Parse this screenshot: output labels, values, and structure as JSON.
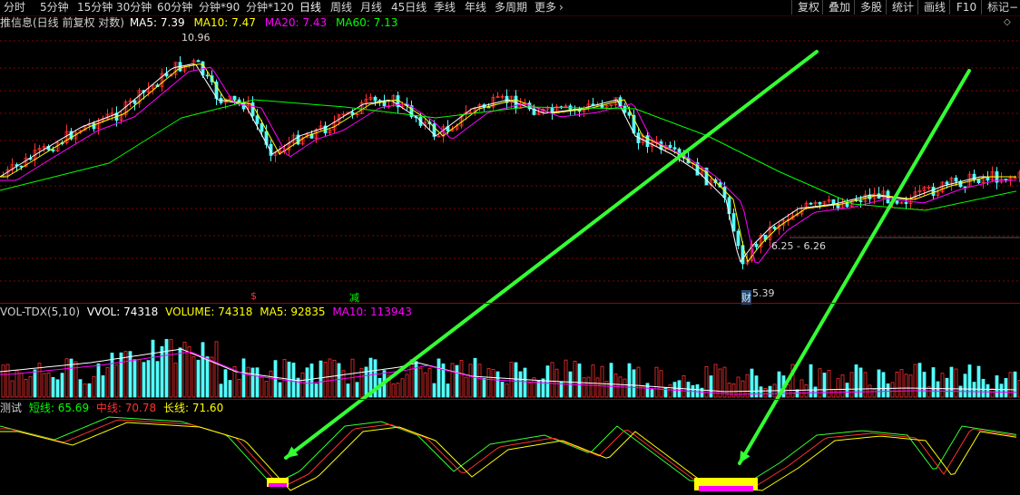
{
  "toolbar": {
    "periods": [
      "分时",
      "5分钟",
      "15分钟",
      "30分钟",
      "60分钟",
      "分钟*90",
      "分钟*120",
      "日线",
      "周线",
      "月线",
      "45日线",
      "季线",
      "年线",
      "多周期",
      "更多"
    ],
    "active_period": "日线",
    "more_chevron": "›",
    "right_buttons": [
      "复权",
      "叠加",
      "多股",
      "统计",
      "画线",
      "F10",
      "标记"
    ],
    "minus_icon": "−"
  },
  "main_panel": {
    "title": "推信息(日线 前复权 对数)",
    "ma5_label": "MA5:",
    "ma5_value": "7.39",
    "ma10_label": "MA10:",
    "ma10_value": "7.47",
    "ma20_label": "MA20:",
    "ma20_value": "7.43",
    "ma60_label": "MA60:",
    "ma60_value": "7.13",
    "high_label": "10.96",
    "low_label": "5.39",
    "range_label": "6.25 - 6.26",
    "event_marker_1": "$",
    "event_marker_2": "减",
    "event_marker_3": "财",
    "diamond_icon": "◇"
  },
  "volume_panel": {
    "title": "VOL-TDX(5,10)",
    "vvol_label": "VVOL:",
    "vvol_value": "74318",
    "volume_label": "VOLUME:",
    "volume_value": "74318",
    "ma5_label": "MA5:",
    "ma5_value": "92835",
    "ma10_label": "MA10:",
    "ma10_value": "113943"
  },
  "indicator_panel": {
    "title": "测试",
    "short_label": "短线:",
    "short_value": "65.69",
    "mid_label": "中线:",
    "mid_value": "70.78",
    "long_label": "长线:",
    "long_value": "71.60"
  },
  "colors": {
    "background": "#000000",
    "up_candle": "#ff3030",
    "down_candle": "#54ffff",
    "ma5": "#ffffff",
    "ma10": "#ffff00",
    "ma20": "#ff00ff",
    "ma60": "#00ff00",
    "arrow": "#33ff33",
    "grid": "#8a0000"
  }
}
